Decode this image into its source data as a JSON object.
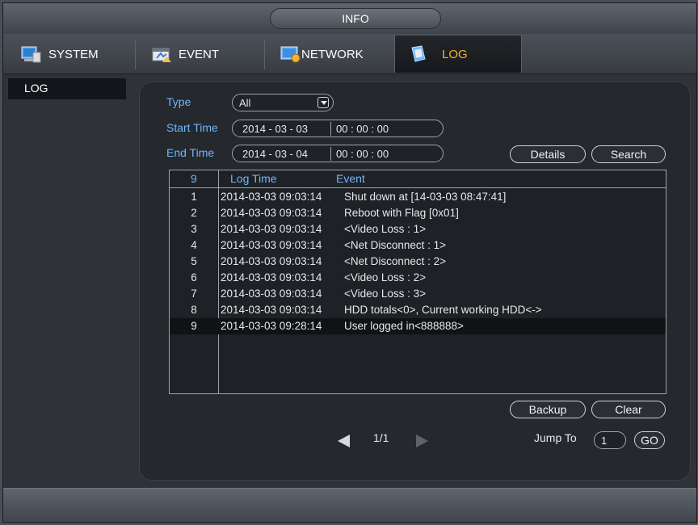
{
  "window": {
    "title": "INFO"
  },
  "tabs": [
    {
      "label": "SYSTEM",
      "icon": "system-monitor-icon",
      "active": false
    },
    {
      "label": "EVENT",
      "icon": "event-icon",
      "active": false
    },
    {
      "label": "NETWORK",
      "icon": "network-icon",
      "active": false
    },
    {
      "label": "LOG",
      "icon": "log-book-icon",
      "active": true
    }
  ],
  "sidebar": {
    "items": [
      {
        "label": "LOG",
        "selected": true
      }
    ]
  },
  "filters": {
    "type_label": "Type",
    "type_value": "All",
    "start_label": "Start Time",
    "start_date": "2014 - 03 - 03",
    "start_time": "00 : 00 : 00",
    "end_label": "End Time",
    "end_date": "2014 - 03 - 04",
    "end_time": "00 : 00 : 00"
  },
  "buttons": {
    "details": "Details",
    "search": "Search",
    "backup": "Backup",
    "clear": "Clear",
    "go": "GO"
  },
  "table": {
    "headers": {
      "index": "9",
      "log_time": "Log Time",
      "event": "Event"
    },
    "rows": [
      {
        "index": "1",
        "time": "2014-03-03 09:03:14",
        "event": "Shut down at [14-03-03 08:47:41]"
      },
      {
        "index": "2",
        "time": "2014-03-03 09:03:14",
        "event": "Reboot with Flag [0x01]"
      },
      {
        "index": "3",
        "time": "2014-03-03 09:03:14",
        "event": "<Video Loss : 1>"
      },
      {
        "index": "4",
        "time": "2014-03-03 09:03:14",
        "event": "<Net Disconnect : 1>"
      },
      {
        "index": "5",
        "time": "2014-03-03 09:03:14",
        "event": "<Net Disconnect : 2>"
      },
      {
        "index": "6",
        "time": "2014-03-03 09:03:14",
        "event": "<Video Loss : 2>"
      },
      {
        "index": "7",
        "time": "2014-03-03 09:03:14",
        "event": "<Video Loss : 3>"
      },
      {
        "index": "8",
        "time": "2014-03-03 09:03:14",
        "event": "HDD totals<0>, Current working HDD<->"
      },
      {
        "index": "9",
        "time": "2014-03-03 09:28:14",
        "event": "User logged in<888888>",
        "selected": true
      }
    ]
  },
  "pager": {
    "page": "1/1",
    "jump_label": "Jump To",
    "jump_value": "1"
  },
  "colors": {
    "accent_label": "#6fb6ff",
    "active_tab": "#f2b33d"
  }
}
